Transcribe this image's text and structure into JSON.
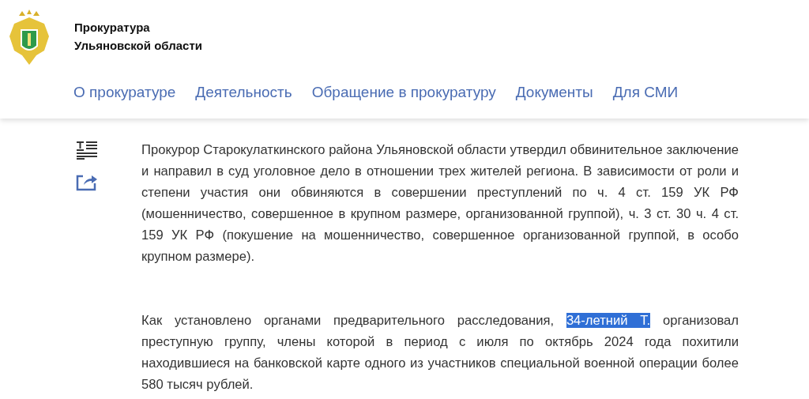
{
  "header": {
    "org_name": [
      "Прокуратура",
      "Ульяновской области"
    ]
  },
  "nav": [
    {
      "label": "О прокуратуре"
    },
    {
      "label": "Деятельность"
    },
    {
      "label": "Обращение в прокуратуру"
    },
    {
      "label": "Документы"
    },
    {
      "label": "Для СМИ"
    }
  ],
  "article": {
    "paragraphs": [
      {
        "parts": [
          {
            "text": "Прокурор Старокулаткинского района Ульяновской области утвердил обвинительное заключение и направил в суд уголовное дело в отношении трех жителей региона. В зависимости от роли и степени участия они обвиняются в совершении преступлений по ч. 4 ст. 159 УК РФ (мошенничество, совершенное в крупном размере, организованной группой), ч. 3 ст. 30 ч. 4 ст. 159 УК РФ (покушение на мошенничество, совершенное организованной группой, в особо крупном размере).",
            "selected": false
          }
        ]
      },
      {
        "parts": [
          {
            "text": "Как установлено органами предварительного расследования, ",
            "selected": false
          },
          {
            "text": "34-летний Т.",
            "selected": true
          },
          {
            "text": " организовал преступную группу, члены которой в период с июля по октябрь 2024 года похитили находившиеся на банковской карте одного из участников специальной военной операции более 580 тысяч рублей.",
            "selected": false
          }
        ]
      }
    ]
  }
}
